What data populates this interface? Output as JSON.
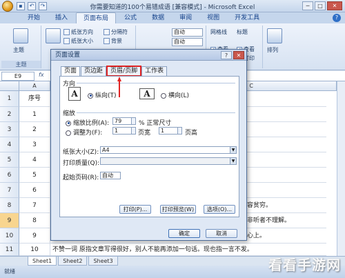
{
  "window": {
    "title": "你需要知道的100个易错成语 [兼容模式] - Microsoft Excel",
    "qat": [
      "save-icon",
      "undo-icon",
      "redo-icon"
    ],
    "controls": [
      "─",
      "□",
      "✕"
    ]
  },
  "ribbon": {
    "tabs": [
      "开始",
      "插入",
      "页面布局",
      "公式",
      "数据",
      "审阅",
      "视图",
      "开发工具"
    ],
    "active_tab": "页面布局",
    "groups": {
      "theme": {
        "button": "主题",
        "label": "主题"
      },
      "page_setup": {
        "items": [
          "纸张方向",
          "纸张大小",
          "分隔符",
          "背景"
        ]
      },
      "scale": {
        "selects": [
          "自动",
          "自动"
        ]
      },
      "sheet_options": {
        "headers": [
          "网格线",
          "标题"
        ],
        "view": [
          "查看",
          "查看"
        ],
        "print": [
          "打印",
          "打印"
        ]
      },
      "arrange": {
        "label": "排列"
      }
    }
  },
  "formula_bar": {
    "name_box": "E9",
    "fx": "fx"
  },
  "grid": {
    "col_headers": [
      "A",
      "C"
    ],
    "rows": [
      {
        "num": "1",
        "a": "序号",
        "b": ""
      },
      {
        "num": "2",
        "a": "1",
        "b": "笑。"
      },
      {
        "num": "3",
        "a": "2",
        "b": ""
      },
      {
        "num": "4",
        "a": "3",
        "b": ""
      },
      {
        "num": "5",
        "a": "4",
        "b": "恩。"
      },
      {
        "num": "6",
        "a": "5",
        "b": ""
      },
      {
        "num": "7",
        "a": "6",
        "b": ""
      },
      {
        "num": "8",
        "a": "7",
        "b": "容贫穷。"
      },
      {
        "num": "9",
        "a": "8",
        "b": "非听者不理解。"
      },
      {
        "num": "10",
        "a": "9",
        "b": "心上。"
      },
      {
        "num": "11",
        "a": "10",
        "b": "不赞一词 原指文章写得很好，别人不能再添加一句话。现也指一言不发。"
      }
    ],
    "selected_row": "9"
  },
  "sheets": [
    "Sheet1",
    "Sheet2",
    "Sheet3"
  ],
  "status": "就绪",
  "dialog": {
    "title": "页面设置",
    "tabs": [
      "页面",
      "页边距",
      "页眉/页脚",
      "工作表"
    ],
    "active_tab": "页面",
    "highlighted_tab": "页眉/页脚",
    "orientation": {
      "label": "方向",
      "portrait": "纵向(T)",
      "landscape": "横向(L)",
      "portrait_glyph": "A",
      "landscape_glyph": "A"
    },
    "scaling": {
      "label": "缩放",
      "adjust_label": "缩放比例(A):",
      "adjust_value": "79",
      "adjust_suffix": "% 正常尺寸",
      "fit_label": "调整为(F):",
      "fit_wide": "1",
      "fit_wide_suffix": "页宽",
      "fit_tall": "1",
      "fit_tall_suffix": "页高"
    },
    "paper_size": {
      "label": "纸张大小(Z):",
      "value": "A4"
    },
    "print_quality": {
      "label": "打印质量(Q):",
      "value": ""
    },
    "first_page": {
      "label": "起始页码(R):",
      "value": "自动"
    },
    "buttons": {
      "print": "打印(P)...",
      "preview": "打印预览(W)",
      "options": "选项(O)...",
      "ok": "确定",
      "cancel": "取消"
    }
  },
  "watermark": "看看手游网",
  "colors": {
    "highlight": "#e02424",
    "ribbon_bg": "#dbe5f1",
    "dialog_bg": "#dfe8f5"
  }
}
